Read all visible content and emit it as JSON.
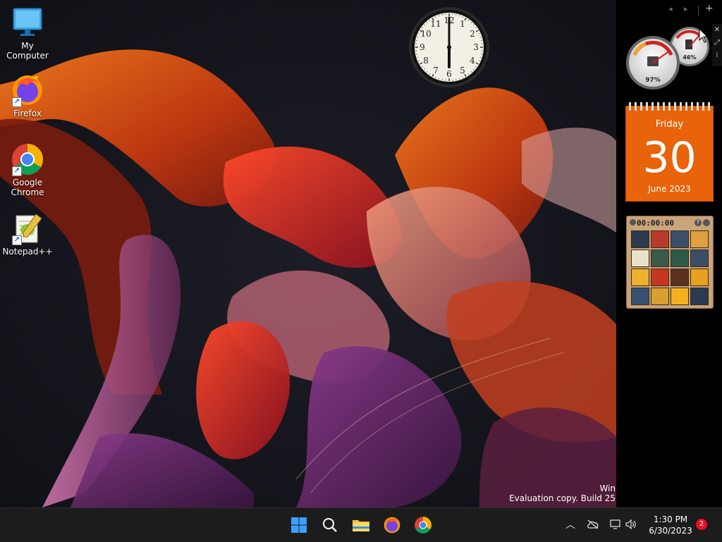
{
  "desktop": {
    "icons": [
      {
        "label": "My Computer",
        "icon": "monitor-icon"
      },
      {
        "label": "Firefox",
        "icon": "firefox-icon"
      },
      {
        "label": "Google Chrome",
        "icon": "chrome-icon"
      },
      {
        "label": "Notepad++",
        "icon": "notepadpp-icon"
      }
    ],
    "watermark": {
      "line1": "Win",
      "line2": "Evaluation copy. Build 25"
    }
  },
  "clock_gadget": {
    "numerals": [
      "12",
      "1",
      "2",
      "3",
      "4",
      "5",
      "6",
      "7",
      "8",
      "9",
      "10",
      "11"
    ],
    "time": "6:00"
  },
  "sidebar": {
    "controls": [
      "◂",
      "▸",
      "+"
    ],
    "meter": {
      "cpu_percent": "97%",
      "memory_percent": "46%"
    },
    "calendar": {
      "weekday": "Friday",
      "day": "30",
      "month_year": "June 2023"
    },
    "puzzle": {
      "timer": "00:00:00",
      "tiles": [
        "#2b3a4d",
        "#b83a2a",
        "#3b4f6a",
        "#e0a040",
        "#e8e0c8",
        "#3a5a4a",
        "#2f5a48",
        "#3a4e66",
        "#f0b030",
        "#c8361e",
        "#5a3020",
        "#e8a020",
        "#355070",
        "#d8a030",
        "#f5b020",
        "#2a3a50"
      ]
    }
  },
  "taskbar": {
    "time": "1:30 PM",
    "date": "6/30/2023",
    "notification_count": "2"
  },
  "colors": {
    "taskbar_bg": "#1c1c1c",
    "calendar_orange": "#e8630a",
    "windows_blue": "#0a84ff"
  }
}
